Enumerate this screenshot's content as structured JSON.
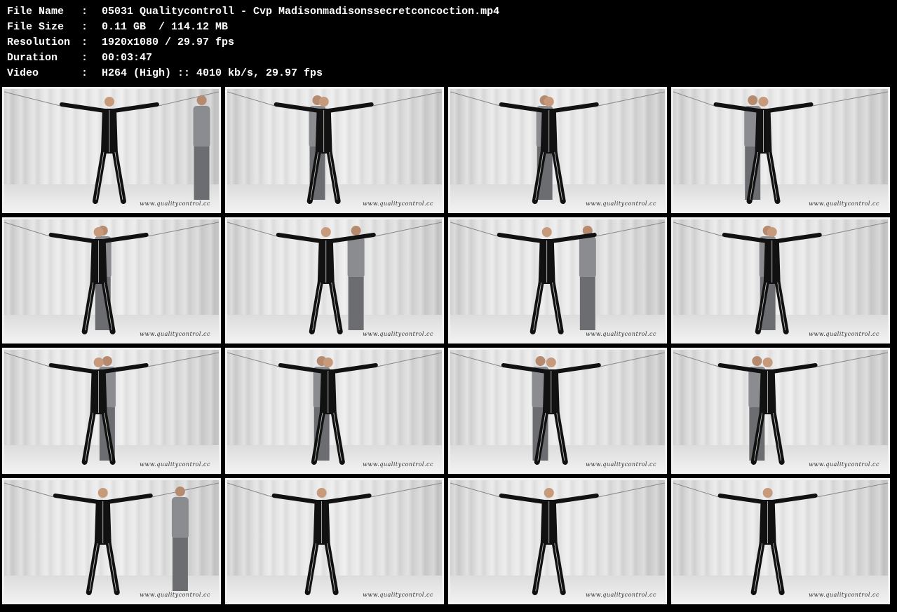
{
  "header": {
    "rows": [
      {
        "label": "File Name",
        "sep": ":",
        "value": "05031 Qualitycontroll - Cvp Madisonmadisonssecretconcoction.mp4"
      },
      {
        "label": "File Size",
        "sep": ":",
        "value": "0.11 GB  / 114.12 MB"
      },
      {
        "label": "Resolution",
        "sep": ":",
        "value": "1920x1080 / 29.97 fps"
      },
      {
        "label": "Duration",
        "sep": ":",
        "value": "00:03:47"
      },
      {
        "label": "Video",
        "sep": ":",
        "value": "H264 (High) :: 4010 kb/s, 29.97 fps"
      }
    ]
  },
  "thumbnails": {
    "count": 16,
    "watermark": "www.qualitycontrol.cc"
  }
}
